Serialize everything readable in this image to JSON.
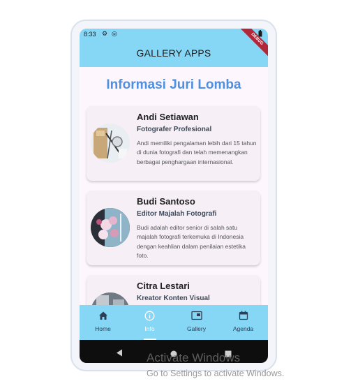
{
  "status_bar": {
    "time": "8:33",
    "icons": [
      "gear-icon",
      "sync-icon",
      "battery-icon"
    ]
  },
  "debug_banner": "DEBUG",
  "app_bar": {
    "title": "GALLERY APPS"
  },
  "page": {
    "heading": "Informasi Juri Lomba"
  },
  "judges": [
    {
      "name": "Andi Setiawan",
      "role": "Fotografer Profesional",
      "description": "Andi memiliki pengalaman lebih dari 15 tahun di dunia fotografi dan telah memenangkan berbagai penghargaan internasional.",
      "avatar": "camera-photo"
    },
    {
      "name": "Budi Santoso",
      "role": "Editor Majalah Fotografi",
      "description": "Budi adalah editor senior di salah satu majalah fotografi terkemuka di Indonesia dengan keahlian dalam penilaian estetika foto.",
      "avatar": "flowers-photo"
    },
    {
      "name": "Citra Lestari",
      "role": "Kreator Konten Visual",
      "description": "",
      "avatar": "grey-photo"
    }
  ],
  "bottom_nav": {
    "items": [
      {
        "label": "Home",
        "icon": "home-icon",
        "active": false
      },
      {
        "label": "Info",
        "icon": "info-icon",
        "active": true
      },
      {
        "label": "Gallery",
        "icon": "gallery-icon",
        "active": false
      },
      {
        "label": "Agenda",
        "icon": "calendar-icon",
        "active": false
      }
    ]
  },
  "system_nav": [
    "back-icon",
    "home-circle-icon",
    "recents-icon"
  ],
  "watermark": {
    "line1": "Activate Windows",
    "line2": "Go to Settings to activate Windows."
  },
  "colors": {
    "app_bar": "#86d6f6",
    "heading": "#4d8fe0",
    "card": "#f6eff6",
    "background": "#fdf7fd"
  }
}
